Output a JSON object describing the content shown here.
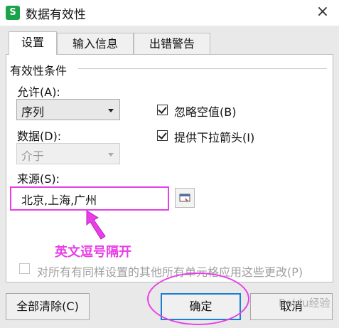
{
  "window": {
    "title": "数据有效性",
    "app_icon": "S",
    "close_glyph": "×"
  },
  "tabs": [
    "设置",
    "输入信息",
    "出错警告"
  ],
  "group": {
    "title": "有效性条件"
  },
  "allow": {
    "label": "允许(A):",
    "value": "序列"
  },
  "data": {
    "label": "数据(D):",
    "value": "介于"
  },
  "checkboxes": {
    "ignore_blank": "忽略空值(B)",
    "dropdown": "提供下拉箭头(I)"
  },
  "source": {
    "label": "来源(S):",
    "value": "北京,上海,广州"
  },
  "annotation": "英文逗号隔开",
  "apply_all": "对所有有同样设置的其他所有单元格应用这些更改(P)",
  "buttons": {
    "clear": "全部清除(C)",
    "ok": "确定",
    "cancel": "取消"
  },
  "watermark": "Baidu经验",
  "colors": {
    "highlight": "#e83ee8",
    "focus": "#1a7fd4",
    "app_icon": "#1aa34a"
  }
}
